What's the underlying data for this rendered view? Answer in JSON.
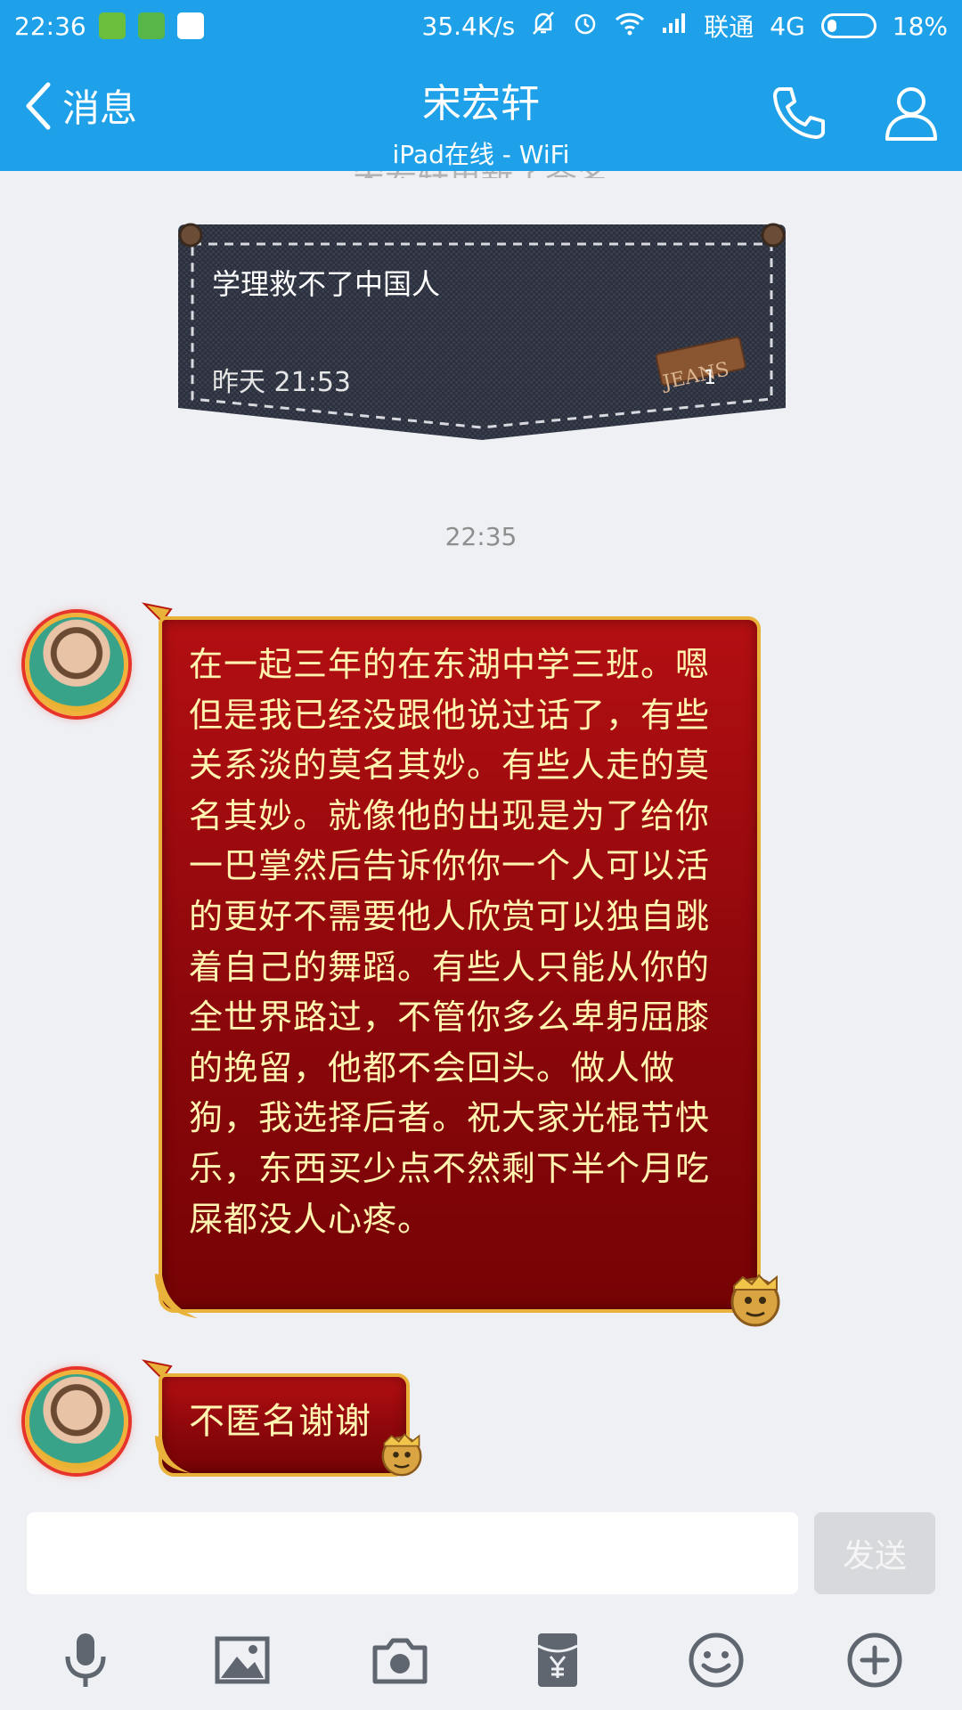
{
  "status_bar": {
    "time": "22:36",
    "speed": "35.4K/s",
    "carrier": "联通",
    "network": "4G",
    "battery": "18%",
    "icons": [
      "shield-icon",
      "frog-icon",
      "qq-icon",
      "mute-icon",
      "alarm-icon",
      "wifi-icon",
      "signal-icon",
      "battery-icon"
    ]
  },
  "header": {
    "back_label": "消息",
    "title": "宋宏轩",
    "subtitle": "iPad在线 - WiFi",
    "colors": {
      "bar": "#1ea1e8",
      "text": "#ffffff"
    }
  },
  "chat": {
    "faded_notice": "宋宏轩更新了签名",
    "signature_card": {
      "text": "学理救不了中国人",
      "time": "昨天 21:53",
      "badge": "JEANS",
      "count": "1"
    },
    "timestamp": "22:35",
    "messages": [
      {
        "text": "在一起三年的在东湖中学三班。嗯但是我已经没跟他说过话了，有些关系淡的莫名其妙。有些人走的莫名其妙。就像他的出现是为了给你一巴掌然后告诉你你一个人可以活的更好不需要他人欣赏可以独自跳着自己的舞蹈。有些人只能从你的全世界路过，不管你多么卑躬屈膝的挽留，他都不会回头。做人做狗，我选择后者。祝大家光棍节快乐，东西买少点不然剩下半个月吃屎都没人心疼。"
      },
      {
        "text": "不匿名谢谢"
      }
    ],
    "bubble_colors": {
      "fill": "#9a0a0e",
      "border": "#e9b23a",
      "text": "#fff4b0"
    }
  },
  "composer": {
    "input_value": "",
    "send_label": "发送"
  },
  "toolbar": {
    "icons": [
      "microphone-icon",
      "image-icon",
      "camera-icon",
      "red-packet-icon",
      "emoji-icon",
      "plus-icon"
    ]
  }
}
